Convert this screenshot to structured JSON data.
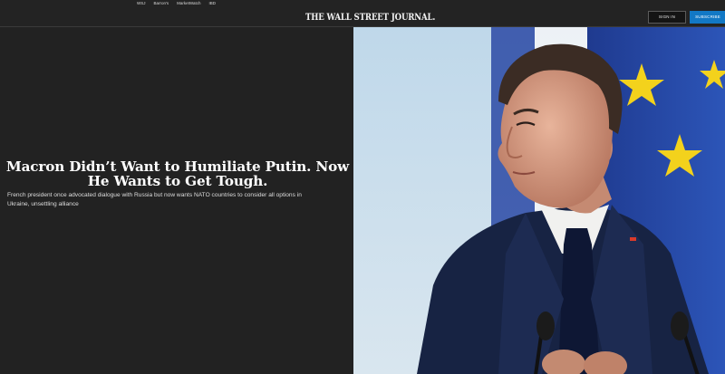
{
  "topbar": {
    "links": [
      "WSJ",
      "Barron's",
      "MarketWatch",
      "IBD"
    ],
    "masthead": "THE WALL STREET JOURNAL.",
    "signin_label": "SIGN IN",
    "subscribe_label": "SUBSCRIBE"
  },
  "article": {
    "headline": "Macron Didn’t Want to Humiliate Putin. Now He Wants to Get Tough.",
    "dek": "French president once advocated dialogue with Russia but now wants NATO countries to consider all options in Ukraine, unsettling alliance"
  },
  "colors": {
    "background": "#222222",
    "subscribe": "#1278c5",
    "eu_blue": "#1d3f9a",
    "eu_star": "#f3d21c"
  },
  "icons": [
    "masthead-logo"
  ]
}
